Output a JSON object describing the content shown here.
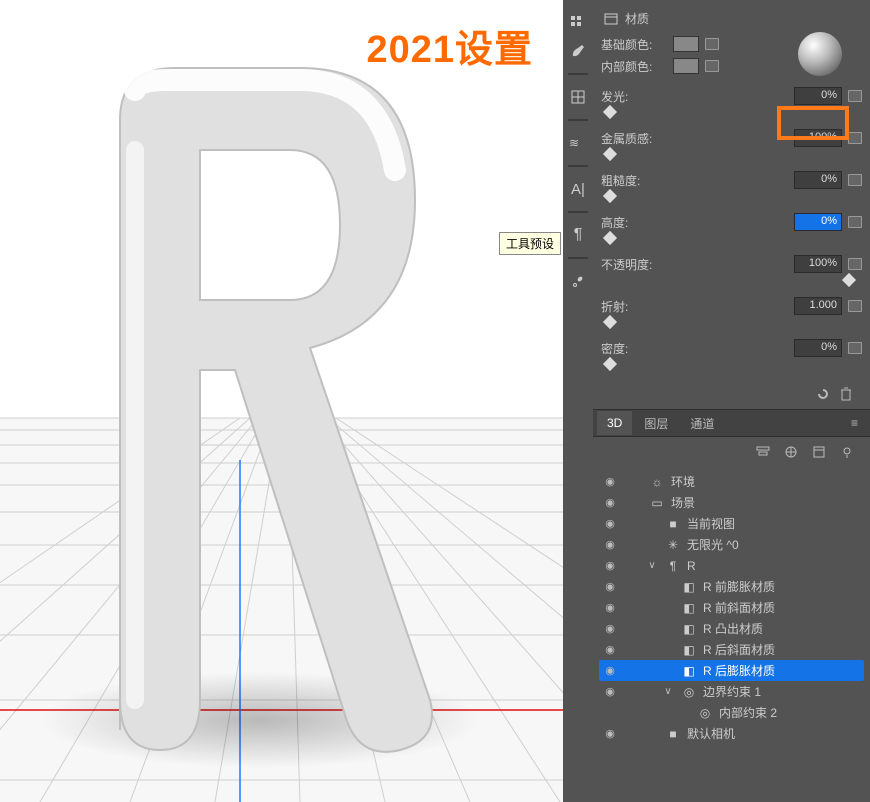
{
  "viewport": {
    "title": "2021设置"
  },
  "toolstrip": {
    "tools": [
      "presets",
      "brush",
      "grid",
      "text-3d",
      "align",
      "paragraph",
      "wrench"
    ],
    "tooltip": "工具预设"
  },
  "material": {
    "header": "材质",
    "base_color_label": "基础颜色:",
    "inner_color_label": "内部颜色:",
    "props": [
      {
        "key": "glow",
        "label": "发光:",
        "value": "0%",
        "slider": "left"
      },
      {
        "key": "metallic",
        "label": "金属质感:",
        "value": "100%",
        "slider": "left",
        "highlight": true
      },
      {
        "key": "roughness",
        "label": "粗糙度:",
        "value": "0%",
        "slider": "left"
      },
      {
        "key": "height",
        "label": "高度:",
        "value": "0%",
        "slider": "left",
        "selected": true
      },
      {
        "key": "opacity",
        "label": "不透明度:",
        "value": "100%",
        "slider": "right"
      },
      {
        "key": "refraction",
        "label": "折射:",
        "value": "1.000",
        "slider": "left"
      },
      {
        "key": "density",
        "label": "密度:",
        "value": "0%",
        "slider": "left"
      }
    ]
  },
  "panel_tabs": {
    "tabs": [
      "3D",
      "图层",
      "通道"
    ],
    "active": 0
  },
  "tree": {
    "icon_row": [
      "filters",
      "mask",
      "fx",
      "light"
    ],
    "nodes": [
      {
        "d": 0,
        "eye": true,
        "ico": "☼",
        "label": "环境"
      },
      {
        "d": 0,
        "eye": true,
        "ico": "▭",
        "label": "场景"
      },
      {
        "d": 1,
        "eye": true,
        "ico": "■",
        "label": "当前视图"
      },
      {
        "d": 1,
        "eye": true,
        "ico": "✳",
        "label": "无限光 ^0"
      },
      {
        "d": 1,
        "eye": true,
        "tgl": "∨",
        "ico": "¶",
        "label": "R"
      },
      {
        "d": 2,
        "eye": true,
        "ico": "◧",
        "label": "R 前膨胀材质"
      },
      {
        "d": 2,
        "eye": true,
        "ico": "◧",
        "label": "R 前斜面材质"
      },
      {
        "d": 2,
        "eye": true,
        "ico": "◧",
        "label": "R 凸出材质"
      },
      {
        "d": 2,
        "eye": true,
        "ico": "◧",
        "label": "R 后斜面材质"
      },
      {
        "d": 2,
        "eye": true,
        "ico": "◧",
        "label": "R 后膨胀材质",
        "sel": true
      },
      {
        "d": 2,
        "eye": true,
        "tgl": "∨",
        "ico": "◎",
        "label": "边界约束 1"
      },
      {
        "d": 3,
        "eye": false,
        "ico": "◎",
        "label": "内部约束 2"
      },
      {
        "d": 1,
        "eye": true,
        "ico": "■",
        "label": "默认相机"
      }
    ]
  }
}
